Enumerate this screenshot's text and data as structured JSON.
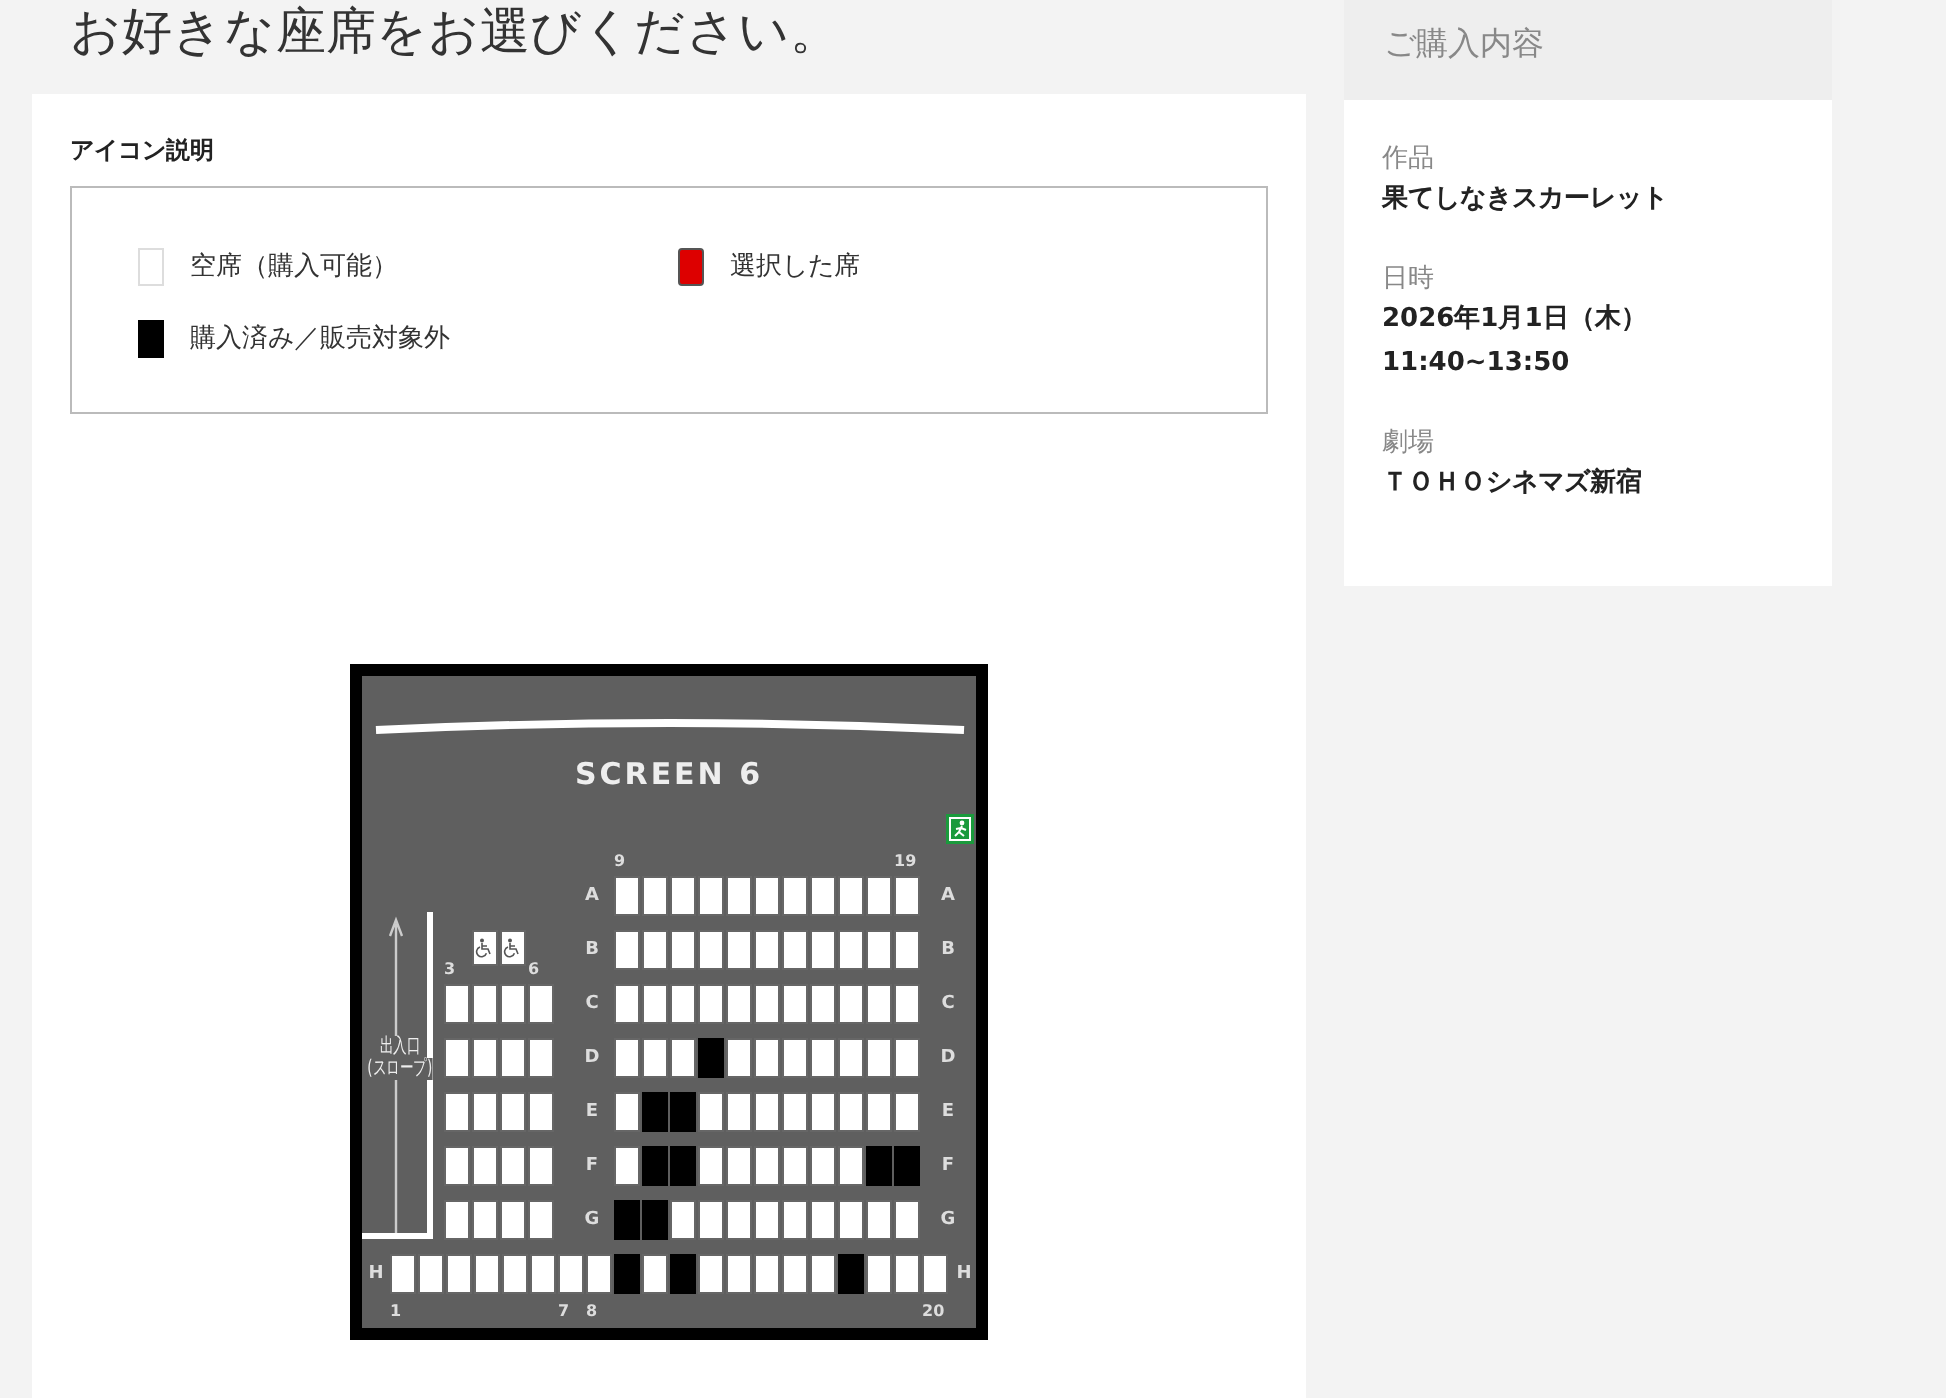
{
  "page_title": "お好きな座席をお選びください。",
  "legend": {
    "title": "アイコン説明",
    "items": [
      {
        "kind": "available",
        "label": "空席（購入可能）"
      },
      {
        "kind": "selected",
        "label": "選択した席"
      },
      {
        "kind": "sold",
        "label": "購入済み／販売対象外"
      }
    ]
  },
  "seat_map": {
    "screen_label": "SCREEN 6",
    "ramp_label": [
      "出入口",
      "(スロープ)"
    ],
    "rows": [
      {
        "kind": "split",
        "row_left": "A",
        "row_right": "A",
        "left": [],
        "right": [
          {
            "kind": "seat",
            "sold": false,
            "label": "9"
          },
          {
            "kind": "seat",
            "sold": false
          },
          {
            "kind": "seat",
            "sold": false
          },
          {
            "kind": "seat",
            "sold": false
          },
          {
            "kind": "seat",
            "sold": false
          },
          {
            "kind": "seat",
            "sold": false
          },
          {
            "kind": "seat",
            "sold": false
          },
          {
            "kind": "seat",
            "sold": false
          },
          {
            "kind": "seat",
            "sold": false
          },
          {
            "kind": "seat",
            "sold": false
          },
          {
            "kind": "seat",
            "sold": false,
            "label": "19"
          }
        ]
      },
      {
        "kind": "split",
        "row_left": "B",
        "row_right": "B",
        "left": [
          {
            "kind": "space"
          },
          {
            "kind": "wheelchair",
            "sold": false
          },
          {
            "kind": "wheelchair",
            "sold": false
          },
          {
            "kind": "space"
          }
        ],
        "right": [
          {
            "kind": "seat",
            "sold": false
          },
          {
            "kind": "seat",
            "sold": false
          },
          {
            "kind": "seat",
            "sold": false
          },
          {
            "kind": "seat",
            "sold": false
          },
          {
            "kind": "seat",
            "sold": false
          },
          {
            "kind": "seat",
            "sold": false
          },
          {
            "kind": "seat",
            "sold": false
          },
          {
            "kind": "seat",
            "sold": false
          },
          {
            "kind": "seat",
            "sold": false
          },
          {
            "kind": "seat",
            "sold": false
          },
          {
            "kind": "seat",
            "sold": false
          }
        ]
      },
      {
        "kind": "split",
        "row_left": "C",
        "row_right": "C",
        "left": [
          {
            "kind": "seat",
            "sold": false,
            "label": "3"
          },
          {
            "kind": "seat",
            "sold": false
          },
          {
            "kind": "seat",
            "sold": false
          },
          {
            "kind": "seat",
            "sold": false,
            "label": "6"
          }
        ],
        "right": [
          {
            "kind": "seat",
            "sold": false
          },
          {
            "kind": "seat",
            "sold": false
          },
          {
            "kind": "seat",
            "sold": false
          },
          {
            "kind": "seat",
            "sold": false
          },
          {
            "kind": "seat",
            "sold": false
          },
          {
            "kind": "seat",
            "sold": false
          },
          {
            "kind": "seat",
            "sold": false
          },
          {
            "kind": "seat",
            "sold": false
          },
          {
            "kind": "seat",
            "sold": false
          },
          {
            "kind": "seat",
            "sold": false
          },
          {
            "kind": "seat",
            "sold": false
          }
        ]
      },
      {
        "kind": "split",
        "row_left": "D",
        "row_right": "D",
        "left": [
          {
            "kind": "seat",
            "sold": false
          },
          {
            "kind": "seat",
            "sold": false
          },
          {
            "kind": "seat",
            "sold": false
          },
          {
            "kind": "seat",
            "sold": false
          }
        ],
        "right": [
          {
            "kind": "seat",
            "sold": false
          },
          {
            "kind": "seat",
            "sold": false
          },
          {
            "kind": "seat",
            "sold": false
          },
          {
            "kind": "seat",
            "sold": true
          },
          {
            "kind": "seat",
            "sold": false
          },
          {
            "kind": "seat",
            "sold": false
          },
          {
            "kind": "seat",
            "sold": false
          },
          {
            "kind": "seat",
            "sold": false
          },
          {
            "kind": "seat",
            "sold": false
          },
          {
            "kind": "seat",
            "sold": false
          },
          {
            "kind": "seat",
            "sold": false
          }
        ]
      },
      {
        "kind": "split",
        "row_left": "E",
        "row_right": "E",
        "left": [
          {
            "kind": "seat",
            "sold": false
          },
          {
            "kind": "seat",
            "sold": false
          },
          {
            "kind": "seat",
            "sold": false
          },
          {
            "kind": "seat",
            "sold": false
          }
        ],
        "right": [
          {
            "kind": "seat",
            "sold": false
          },
          {
            "kind": "seat",
            "sold": true
          },
          {
            "kind": "seat",
            "sold": true
          },
          {
            "kind": "seat",
            "sold": false
          },
          {
            "kind": "seat",
            "sold": false
          },
          {
            "kind": "seat",
            "sold": false
          },
          {
            "kind": "seat",
            "sold": false
          },
          {
            "kind": "seat",
            "sold": false
          },
          {
            "kind": "seat",
            "sold": false
          },
          {
            "kind": "seat",
            "sold": false
          },
          {
            "kind": "seat",
            "sold": false
          }
        ]
      },
      {
        "kind": "split",
        "row_left": "F",
        "row_right": "F",
        "left": [
          {
            "kind": "seat",
            "sold": false
          },
          {
            "kind": "seat",
            "sold": false
          },
          {
            "kind": "seat",
            "sold": false
          },
          {
            "kind": "seat",
            "sold": false
          }
        ],
        "right": [
          {
            "kind": "seat",
            "sold": false
          },
          {
            "kind": "seat",
            "sold": true
          },
          {
            "kind": "seat",
            "sold": true
          },
          {
            "kind": "seat",
            "sold": false
          },
          {
            "kind": "seat",
            "sold": false
          },
          {
            "kind": "seat",
            "sold": false
          },
          {
            "kind": "seat",
            "sold": false
          },
          {
            "kind": "seat",
            "sold": false
          },
          {
            "kind": "seat",
            "sold": false
          },
          {
            "kind": "seat",
            "sold": true
          },
          {
            "kind": "seat",
            "sold": true
          }
        ]
      },
      {
        "kind": "split",
        "row_left": "G",
        "row_right": "G",
        "left": [
          {
            "kind": "seat",
            "sold": false
          },
          {
            "kind": "seat",
            "sold": false
          },
          {
            "kind": "seat",
            "sold": false
          },
          {
            "kind": "seat",
            "sold": false
          }
        ],
        "right": [
          {
            "kind": "seat",
            "sold": true
          },
          {
            "kind": "seat",
            "sold": true
          },
          {
            "kind": "seat",
            "sold": false
          },
          {
            "kind": "seat",
            "sold": false
          },
          {
            "kind": "seat",
            "sold": false
          },
          {
            "kind": "seat",
            "sold": false
          },
          {
            "kind": "seat",
            "sold": false
          },
          {
            "kind": "seat",
            "sold": false
          },
          {
            "kind": "seat",
            "sold": false
          },
          {
            "kind": "seat",
            "sold": false
          },
          {
            "kind": "seat",
            "sold": false
          }
        ]
      },
      {
        "kind": "full",
        "row_left": "H",
        "row_right": "H",
        "seats": [
          {
            "kind": "seat",
            "sold": false,
            "label": "1"
          },
          {
            "kind": "seat",
            "sold": false
          },
          {
            "kind": "seat",
            "sold": false
          },
          {
            "kind": "seat",
            "sold": false
          },
          {
            "kind": "seat",
            "sold": false
          },
          {
            "kind": "seat",
            "sold": false
          },
          {
            "kind": "seat",
            "sold": false,
            "label": "7"
          },
          {
            "kind": "seat",
            "sold": false,
            "label": "8"
          },
          {
            "kind": "seat",
            "sold": true
          },
          {
            "kind": "seat",
            "sold": false
          },
          {
            "kind": "seat",
            "sold": true
          },
          {
            "kind": "seat",
            "sold": false
          },
          {
            "kind": "seat",
            "sold": false
          },
          {
            "kind": "seat",
            "sold": false
          },
          {
            "kind": "seat",
            "sold": false
          },
          {
            "kind": "seat",
            "sold": false
          },
          {
            "kind": "seat",
            "sold": true
          },
          {
            "kind": "seat",
            "sold": false
          },
          {
            "kind": "seat",
            "sold": false
          },
          {
            "kind": "seat",
            "sold": false,
            "label": "20"
          }
        ]
      }
    ]
  },
  "summary": {
    "title": "ご購入内容",
    "fields": [
      {
        "label": "作品",
        "lines": [
          "果てしなきスカーレット"
        ]
      },
      {
        "label": "日時",
        "lines": [
          "2026年1月1日（木）",
          "11:40~13:50"
        ]
      },
      {
        "label": "劇場",
        "lines": [
          "ＴＯＨＯシネマズ新宿"
        ]
      }
    ]
  }
}
